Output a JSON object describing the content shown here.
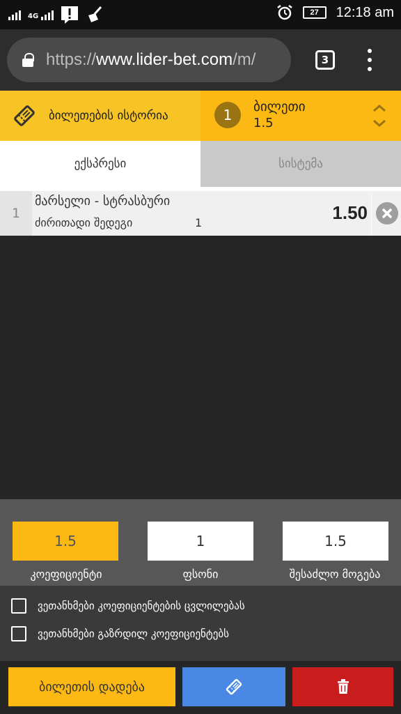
{
  "status_bar": {
    "network": "4G",
    "battery": "27",
    "time": "12:18 am"
  },
  "browser": {
    "url_scheme": "https://",
    "url_host": "www.lider-bet.com",
    "url_rest": "/m/",
    "tab_count": "3"
  },
  "header": {
    "history_label": "ბილეთების ისტორია",
    "ticket_count": "1",
    "ticket_title": "ბილეთი",
    "ticket_total_odds": "1.5"
  },
  "tabs": [
    {
      "label": "ექსპრესი",
      "active": true
    },
    {
      "label": "სისტემა",
      "active": false
    }
  ],
  "bets": [
    {
      "index": "1",
      "match": "მარსელი - სტრასბური",
      "market": "ძირითადი შედეგი",
      "pick": "1",
      "odds": "1.50"
    }
  ],
  "summary": {
    "odds_value": "1.5",
    "odds_label": "კოეფიციენტი",
    "stake_value": "1",
    "stake_label": "ფსონი",
    "win_value": "1.5",
    "win_label": "შესაძლო მოგება"
  },
  "options": {
    "accept_odds_change": "ვეთანხმები კოეფიციენტების ცვლილებას",
    "accept_odds_increase": "ვეთანხმები გაზრდილ კოეფიციენტებს"
  },
  "actions": {
    "place_bet_label": "ბილეთის დადება"
  },
  "colors": {
    "accent": "#fdb913",
    "blue": "#4a88e6",
    "red": "#c91c1c"
  }
}
